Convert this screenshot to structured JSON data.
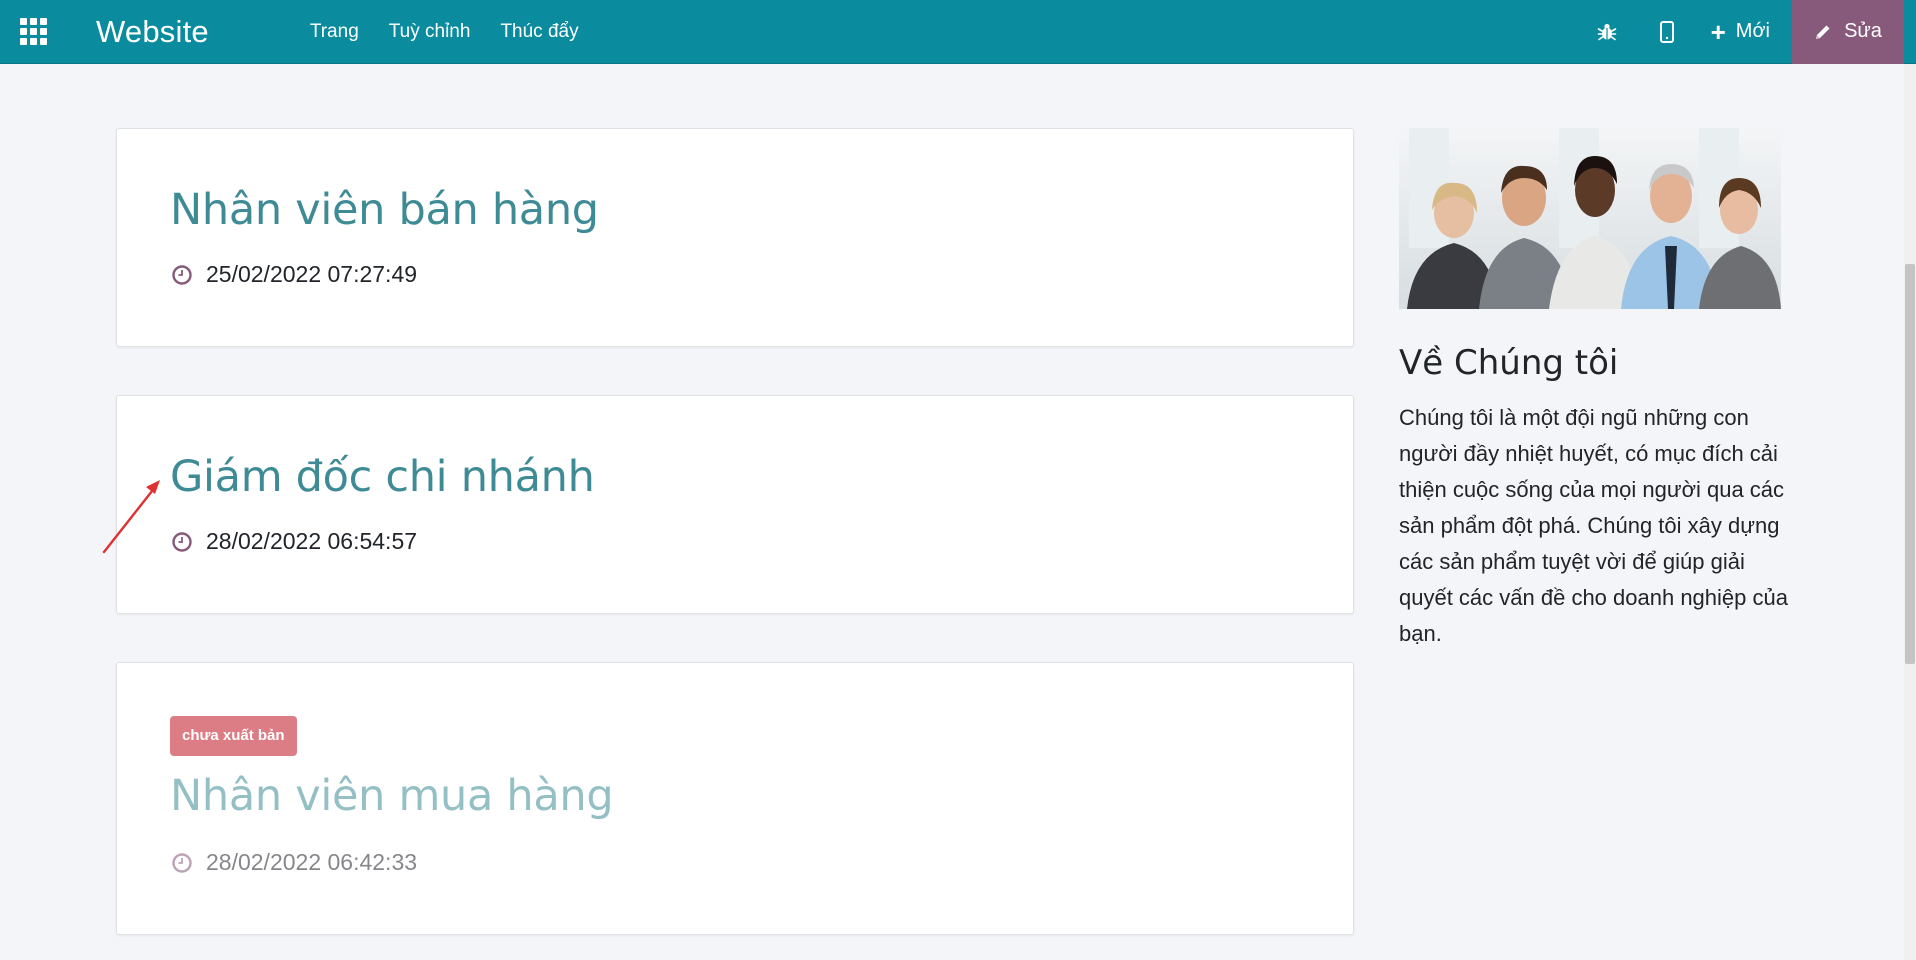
{
  "navbar": {
    "brand": "Website",
    "menu": [
      "Trang",
      "Tuỳ chỉnh",
      "Thúc đẩy"
    ],
    "new_label": "Mới",
    "edit_label": "Sửa",
    "bg_color": "#0b8b9e",
    "edit_color": "#875a7b"
  },
  "posts": [
    {
      "title": "Nhân viên bán hàng",
      "date": "25/02/2022 07:27:49",
      "published": true
    },
    {
      "title": "Giám đốc chi nhánh",
      "date": "28/02/2022 06:54:57",
      "published": true
    },
    {
      "title": "Nhân viên mua hàng",
      "date": "28/02/2022 06:42:33",
      "published": false,
      "badge": "chưa xuất bản"
    }
  ],
  "sidebar": {
    "about_title": "Về Chúng tôi",
    "about_text": "Chúng tôi là một đội ngũ những con người đầy nhiệt huyết, có mục đích cải thiện cuộc sống của mọi người qua các sản phẩm đột phá. Chúng tôi xây dựng các sản phẩm tuyệt vời để giúp giải quyết các vấn đề cho doanh nghiệp của bạn."
  }
}
